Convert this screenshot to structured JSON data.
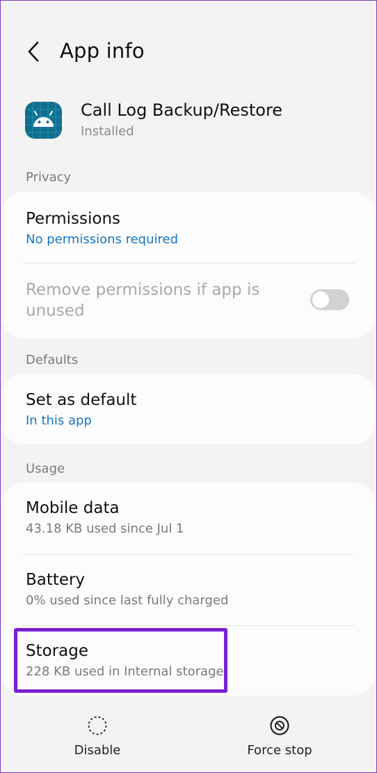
{
  "header": {
    "title": "App info"
  },
  "app": {
    "name": "Call Log Backup/Restore",
    "status": "Installed"
  },
  "sections": {
    "privacy": {
      "label": "Privacy",
      "permissions": {
        "title": "Permissions",
        "subtitle": "No permissions required"
      },
      "remove_permissions": {
        "title": "Remove permissions if app is unused",
        "toggle_on": false
      }
    },
    "defaults": {
      "label": "Defaults",
      "set_default": {
        "title": "Set as default",
        "subtitle": "In this app"
      }
    },
    "usage": {
      "label": "Usage",
      "mobile_data": {
        "title": "Mobile data",
        "subtitle": "43.18 KB used since Jul 1"
      },
      "battery": {
        "title": "Battery",
        "subtitle": "0% used since last fully charged"
      },
      "storage": {
        "title": "Storage",
        "subtitle": "228 KB used in Internal storage"
      }
    }
  },
  "bottom_bar": {
    "disable_label": "Disable",
    "force_stop_label": "Force stop"
  },
  "colors": {
    "accent_link": "#1778c2",
    "highlight": "#7a1fd1",
    "app_icon_bg": "#0e6f8f"
  }
}
